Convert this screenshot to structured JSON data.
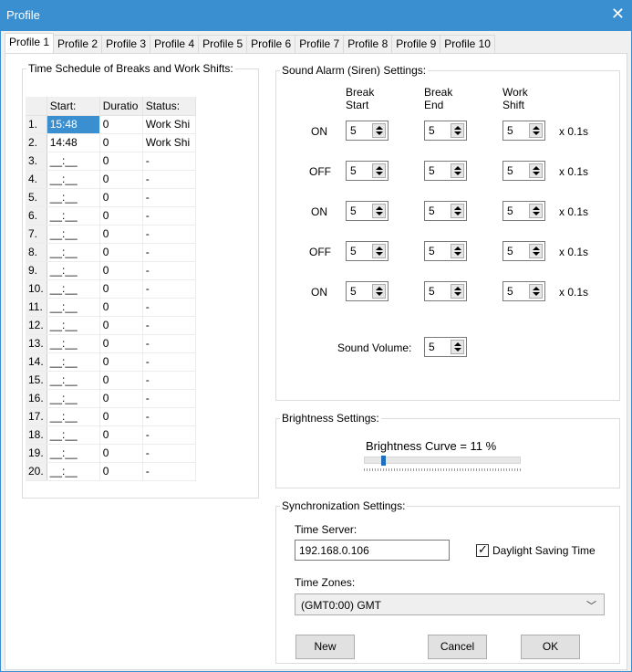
{
  "window": {
    "title": "Profile",
    "close_glyph": "✕"
  },
  "tabs": [
    "Profile 1",
    "Profile 2",
    "Profile 3",
    "Profile 4",
    "Profile 5",
    "Profile 6",
    "Profile 7",
    "Profile 8",
    "Profile 9",
    "Profile 10"
  ],
  "schedule": {
    "legend": "Time Schedule of Breaks and Work Shifts:",
    "headers": [
      "Start:",
      "Duratio",
      "Status:"
    ],
    "rows": [
      {
        "num": "1.",
        "start": "15:48",
        "duration": "0",
        "status": "Work Shi"
      },
      {
        "num": "2.",
        "start": "14:48",
        "duration": "0",
        "status": "Work Shi"
      },
      {
        "num": "3.",
        "start": "__:__",
        "duration": "0",
        "status": "-"
      },
      {
        "num": "4.",
        "start": "__:__",
        "duration": "0",
        "status": "-"
      },
      {
        "num": "5.",
        "start": "__:__",
        "duration": "0",
        "status": "-"
      },
      {
        "num": "6.",
        "start": "__:__",
        "duration": "0",
        "status": "-"
      },
      {
        "num": "7.",
        "start": "__:__",
        "duration": "0",
        "status": "-"
      },
      {
        "num": "8.",
        "start": "__:__",
        "duration": "0",
        "status": "-"
      },
      {
        "num": "9.",
        "start": "__:__",
        "duration": "0",
        "status": "-"
      },
      {
        "num": "10.",
        "start": "__:__",
        "duration": "0",
        "status": "-"
      },
      {
        "num": "11.",
        "start": "__:__",
        "duration": "0",
        "status": "-"
      },
      {
        "num": "12.",
        "start": "__:__",
        "duration": "0",
        "status": "-"
      },
      {
        "num": "13.",
        "start": "__:__",
        "duration": "0",
        "status": "-"
      },
      {
        "num": "14.",
        "start": "__:__",
        "duration": "0",
        "status": "-"
      },
      {
        "num": "15.",
        "start": "__:__",
        "duration": "0",
        "status": "-"
      },
      {
        "num": "16.",
        "start": "__:__",
        "duration": "0",
        "status": "-"
      },
      {
        "num": "17.",
        "start": "__:__",
        "duration": "0",
        "status": "-"
      },
      {
        "num": "18.",
        "start": "__:__",
        "duration": "0",
        "status": "-"
      },
      {
        "num": "19.",
        "start": "__:__",
        "duration": "0",
        "status": "-"
      },
      {
        "num": "20.",
        "start": "__:__",
        "duration": "0",
        "status": "-"
      }
    ]
  },
  "sound": {
    "legend": "Sound Alarm (Siren) Settings:",
    "col_headers": [
      {
        "line1": "Break",
        "line2": "Start"
      },
      {
        "line1": "Break",
        "line2": "End"
      },
      {
        "line1": "Work",
        "line2": "Shift"
      }
    ],
    "rows": [
      {
        "label": "ON",
        "values": [
          "5",
          "5",
          "5"
        ],
        "unit": "x 0.1s"
      },
      {
        "label": "OFF",
        "values": [
          "5",
          "5",
          "5"
        ],
        "unit": "x 0.1s"
      },
      {
        "label": "ON",
        "values": [
          "5",
          "5",
          "5"
        ],
        "unit": "x 0.1s"
      },
      {
        "label": "OFF",
        "values": [
          "5",
          "5",
          "5"
        ],
        "unit": "x 0.1s"
      },
      {
        "label": "ON",
        "values": [
          "5",
          "5",
          "5"
        ],
        "unit": "x 0.1s"
      }
    ],
    "volume_label": "Sound Volume:",
    "volume_value": "5"
  },
  "brightness": {
    "legend": "Brightness Settings:",
    "curve_label": "Brightness Curve = 11 %",
    "level_percent": 11
  },
  "sync": {
    "legend": "Synchronization Settings:",
    "time_server_label": "Time Server:",
    "time_server_value": "192.168.0.106",
    "dst_label": "Daylight Saving Time",
    "dst_checked": true,
    "check_glyph": "✓",
    "timezones_label": "Time Zones:",
    "timezone_value": "(GMT0:00) GMT",
    "dropdown_glyph": "﹀"
  },
  "buttons": {
    "new": "New",
    "cancel": "Cancel",
    "ok": "OK"
  },
  "colors": {
    "accent": "#3a8fd0",
    "selection": "#3a8fd0",
    "thumb": "#1e6fc0"
  }
}
